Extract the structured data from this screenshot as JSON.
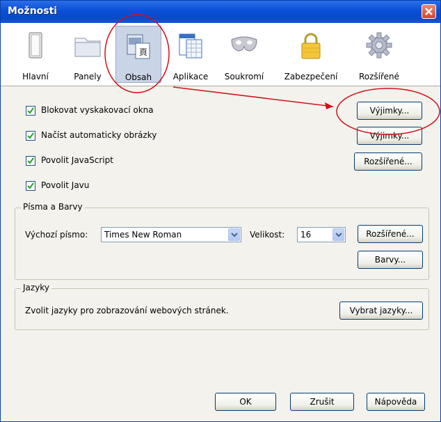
{
  "window": {
    "title": "Možnosti"
  },
  "tabs": [
    {
      "label": "Hlavní",
      "icon": "switch-icon"
    },
    {
      "label": "Panely",
      "icon": "folder-icon"
    },
    {
      "label": "Obsah",
      "icon": "content-page-icon"
    },
    {
      "label": "Aplikace",
      "icon": "calendar-app-icon"
    },
    {
      "label": "Soukromí",
      "icon": "mask-icon"
    },
    {
      "label": "Zabezpečení",
      "icon": "padlock-icon"
    },
    {
      "label": "Rozšířené",
      "icon": "gear-icon"
    }
  ],
  "selected_tab": "Obsah",
  "options": [
    {
      "label": "Blokovat vyskakovací okna",
      "checked": true,
      "button": "Výjimky..."
    },
    {
      "label": "Načíst automaticky obrázky",
      "checked": true,
      "button": "Výjimky..."
    },
    {
      "label": "Povolit JavaScript",
      "checked": true,
      "button": "Rozšířené..."
    },
    {
      "label": "Povolit Javu",
      "checked": true
    }
  ],
  "fonts": {
    "legend": "Písma a Barvy",
    "default_font_label": "Výchozí písmo:",
    "default_font_value": "Times New Roman",
    "size_label": "Velikost:",
    "size_value": "16",
    "advanced_button": "Rozšířené...",
    "colors_button": "Barvy..."
  },
  "languages": {
    "legend": "Jazyky",
    "text": "Zvolit jazyky pro zobrazování webových stránek.",
    "button": "Vybrat jazyky..."
  },
  "footer": {
    "ok": "OK",
    "cancel": "Zrušit",
    "help": "Nápověda"
  },
  "colors": {
    "annotation": "#d0101a",
    "titlebar": "#0a4fd6",
    "panel": "#f3f2ec"
  }
}
